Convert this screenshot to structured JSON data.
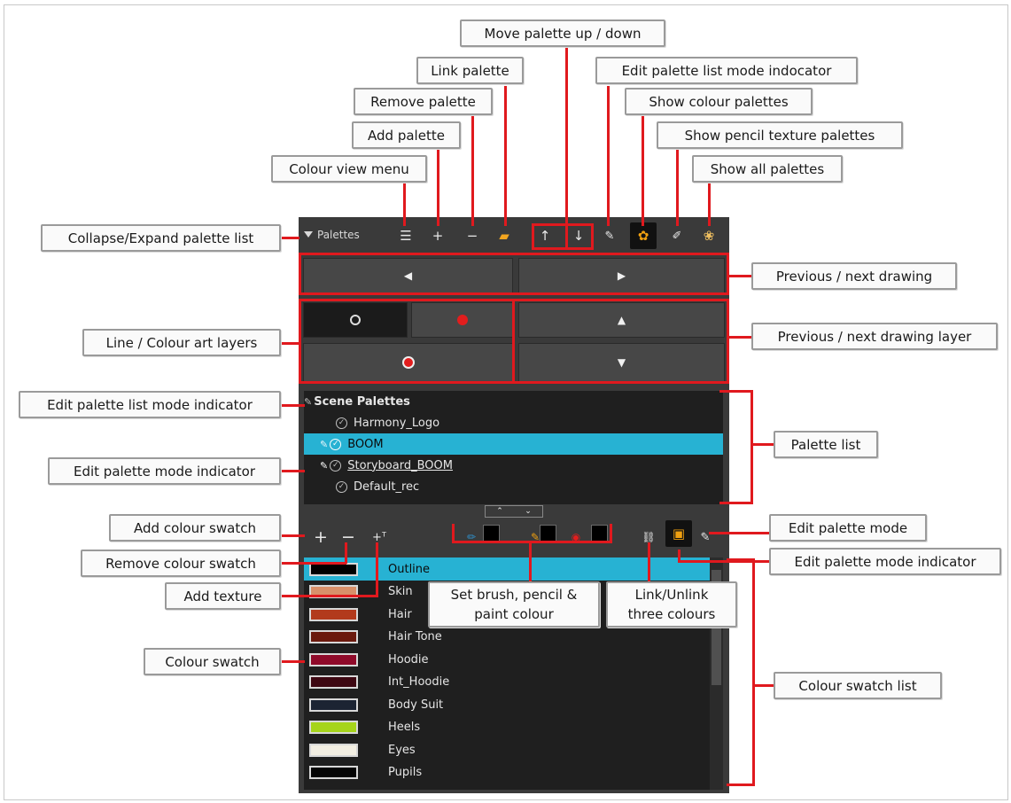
{
  "panel": {
    "title": "Palettes",
    "toolbar_icons": [
      "menu-icon",
      "plus-icon",
      "minus-icon",
      "folder-icon",
      "arrow-up-icon",
      "arrow-down-icon",
      "pen-icon",
      "palette-icon",
      "pencil-texture-icon",
      "all-palettes-icon"
    ],
    "palette_list": {
      "header": "Scene Palettes",
      "items": [
        "Harmony_Logo",
        "BOOM",
        "Storyboard_BOOM",
        "Default_rec"
      ],
      "selected": "BOOM"
    },
    "swatches": [
      {
        "name": "Outline",
        "color": "#000000"
      },
      {
        "name": "Skin",
        "color": "#d9906a"
      },
      {
        "name": "Hair",
        "color": "#b23a1c"
      },
      {
        "name": "Hair Tone",
        "color": "#6b1a0e"
      },
      {
        "name": "Hoodie",
        "color": "#8f0a2a"
      },
      {
        "name": "Int_Hoodie",
        "color": "#3e0712"
      },
      {
        "name": "Body Suit",
        "color": "#1c2433"
      },
      {
        "name": "Heels",
        "color": "#a6d41b"
      },
      {
        "name": "Eyes",
        "color": "#f2eee2"
      },
      {
        "name": "Pupils",
        "color": "#050505"
      }
    ],
    "selected_swatch": "Outline",
    "colors": {
      "accent": "#27b2d3",
      "callout_line": "#e0191e"
    }
  },
  "callouts": {
    "move_palette": "Move palette up / down",
    "link_palette": "Link palette",
    "edit_list_mode_indocator": "Edit palette list mode indocator",
    "remove_palette": "Remove palette",
    "show_colour_palettes": "Show colour palettes",
    "add_palette": "Add palette",
    "show_pencil_texture": "Show pencil texture palettes",
    "colour_view_menu": "Colour view menu",
    "show_all_palettes": "Show all palettes",
    "collapse_expand": "Collapse/Expand palette list",
    "prev_next_drawing": "Previous / next drawing",
    "line_colour_art": "Line / Colour art layers",
    "prev_next_layer": "Previous / next drawing layer",
    "edit_list_mode_indicator": "Edit palette list mode indicator",
    "palette_list": "Palette list",
    "edit_palette_mode_indicator_left": "Edit palette mode indicator",
    "add_colour_swatch": "Add colour swatch",
    "edit_palette_mode": "Edit palette mode",
    "remove_colour_swatch": "Remove colour swatch",
    "edit_palette_mode_indicator_right": "Edit palette mode indicator",
    "add_texture": "Add texture",
    "set_brush_line1": "Set brush, pencil &",
    "set_brush_line2": "paint colour",
    "link_unlink_line1": "Link/Unlink",
    "link_unlink_line2": "three colours",
    "colour_swatch": "Colour swatch",
    "colour_swatch_list": "Colour swatch list"
  }
}
